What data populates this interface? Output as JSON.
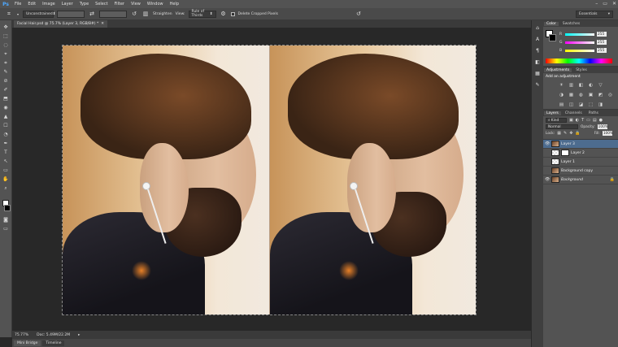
{
  "menubar": {
    "logo": "Ps",
    "items": [
      "File",
      "Edit",
      "Image",
      "Layer",
      "Type",
      "Select",
      "Filter",
      "View",
      "Window",
      "Help"
    ],
    "window_controls": [
      "–",
      "▭",
      "✕"
    ]
  },
  "options": {
    "preset_label": "Unconstrained",
    "straighten_label": "Straighten",
    "view_label": "View:",
    "view_value": "Rule of Thirds",
    "delete_cropped_label": "Delete Cropped Pixels",
    "workspace": "Essentials"
  },
  "document": {
    "tab_title": "Facial Hair.psd @ 75.7% (Layer 3, RGB/8#) *",
    "tab_close": "✕"
  },
  "status": {
    "zoom": "75.77%",
    "doc_info": "Doc: 5.49M/22.2M"
  },
  "bottom_tabs": [
    "Mini Bridge",
    "Timeline"
  ],
  "color_panel": {
    "tabs": [
      "Color",
      "Swatches"
    ],
    "rows": [
      {
        "label": "R",
        "value": "255",
        "color": "#ff0000"
      },
      {
        "label": "G",
        "value": "255",
        "color": "#00ff00"
      },
      {
        "label": "B",
        "value": "255",
        "color": "#0000ff"
      }
    ]
  },
  "adjustments_panel": {
    "tabs": [
      "Adjustments",
      "Styles"
    ],
    "title": "Add an adjustment",
    "icons": [
      "☀",
      "▥",
      "◧",
      "◐",
      "▽",
      "◑",
      "▦",
      "◍",
      "▣",
      "◩",
      "◎",
      "▤",
      "◫",
      "◪",
      "⬚",
      "◨"
    ]
  },
  "layers_panel": {
    "tabs": [
      "Layers",
      "Channels",
      "Paths"
    ],
    "filter_label": "Kind",
    "blend_mode": "Normal",
    "opacity_label": "Opacity:",
    "opacity_value": "100%",
    "lock_label": "Lock:",
    "fill_label": "Fill:",
    "fill_value": "100%",
    "layers": [
      {
        "name": "Layer 3",
        "thumb": "photo",
        "selected": true,
        "visible": true,
        "mask": false,
        "italic": false,
        "locked": false
      },
      {
        "name": "Layer 2",
        "thumb": "checker",
        "selected": false,
        "visible": false,
        "mask": true,
        "italic": false,
        "locked": false
      },
      {
        "name": "Layer 1",
        "thumb": "checker",
        "selected": false,
        "visible": false,
        "mask": false,
        "italic": false,
        "locked": false
      },
      {
        "name": "Background copy",
        "thumb": "photo",
        "selected": false,
        "visible": false,
        "mask": false,
        "italic": false,
        "locked": false
      },
      {
        "name": "Background",
        "thumb": "photo",
        "selected": false,
        "visible": true,
        "mask": false,
        "italic": true,
        "locked": true
      }
    ]
  },
  "icons": {
    "tools": [
      "✥",
      "⬚",
      "◌",
      "⌖",
      "⌗",
      "✎",
      "⊘",
      "✐",
      "⬒",
      "◉",
      "▲",
      "☐",
      "◔",
      "✒",
      "T",
      "↖",
      "▭",
      "✋",
      "⌕"
    ],
    "strip": [
      "⌂",
      "A",
      "¶",
      "◧",
      "▦",
      "✎"
    ],
    "eye": "👁",
    "lock": "🔒",
    "search": "⌕"
  }
}
